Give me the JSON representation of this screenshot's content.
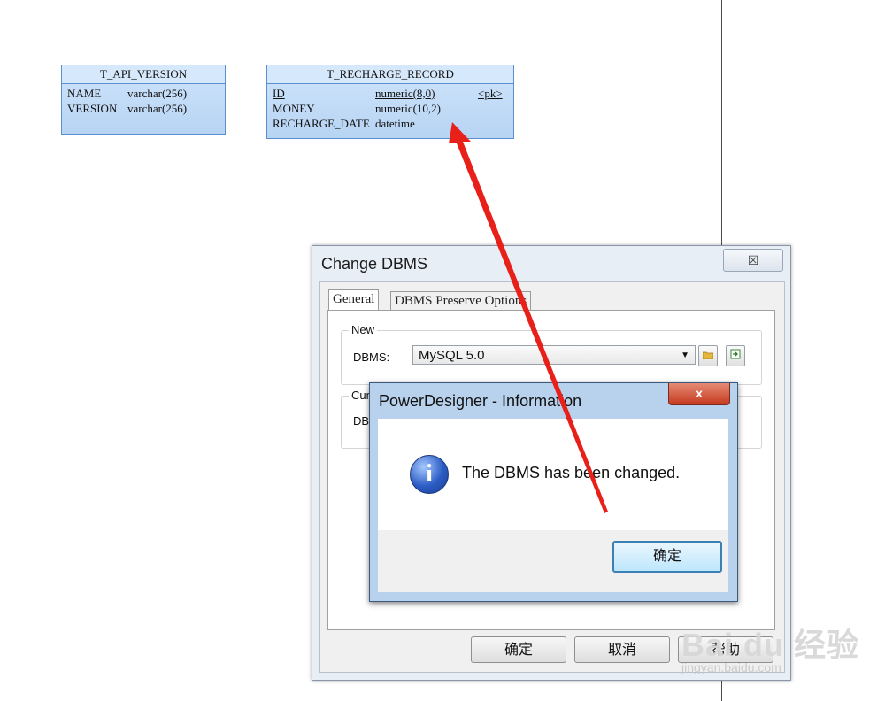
{
  "diagram": {
    "tables": [
      {
        "name": "T_API_VERSION",
        "columns": [
          {
            "name": "NAME",
            "type": "varchar(256)"
          },
          {
            "name": "VERSION",
            "type": "varchar(256)"
          }
        ]
      },
      {
        "name": "T_RECHARGE_RECORD",
        "columns": [
          {
            "name": "ID",
            "type": "numeric(8,0)",
            "key": "<pk>"
          },
          {
            "name": "MONEY",
            "type": "numeric(10,2)"
          },
          {
            "name": "RECHARGE_DATE",
            "type": "datetime"
          }
        ]
      }
    ]
  },
  "change_dbms": {
    "title": "Change DBMS",
    "close_glyph": "☒",
    "tabs": [
      {
        "label": "General",
        "active": true
      },
      {
        "label": "DBMS Preserve Options",
        "active": false
      }
    ],
    "new_group": {
      "label": "New",
      "dbms_label": "DBMS:",
      "dbms_value": "MySQL 5.0"
    },
    "current_group": {
      "label": "Cur",
      "dbms_label": "DB"
    },
    "buttons": {
      "ok": "确定",
      "cancel": "取消",
      "help": "帮助"
    }
  },
  "info_box": {
    "title": "PowerDesigner - Information",
    "close_glyph": "x",
    "icon": "info-icon",
    "message": "The DBMS has been changed.",
    "ok_label": "确定"
  },
  "watermark": {
    "main": "Bai du 经验",
    "sub": "jingyan.baidu.com"
  },
  "colors": {
    "accent": "#e8201a",
    "table_fill": "#c3dbf7",
    "table_border": "#5a8fd0"
  }
}
